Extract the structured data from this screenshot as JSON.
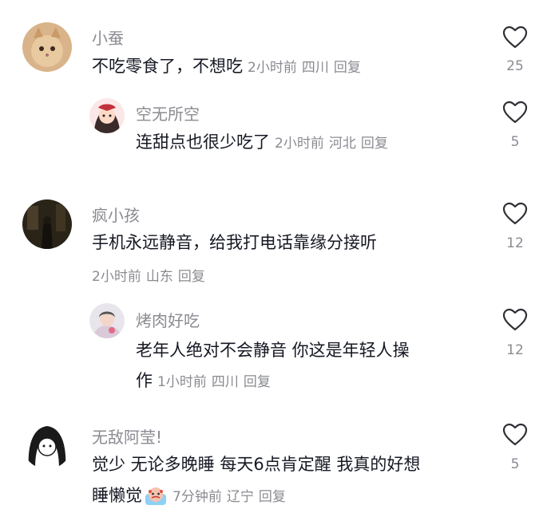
{
  "comments": [
    {
      "username": "小蚕",
      "text": "不吃零食了，不想吃",
      "time": "2小时前",
      "location": "四川",
      "reply_label": "回复",
      "likes": "25"
    },
    {
      "username": "空无所空",
      "text": "连甜点也很少吃了",
      "time": "2小时前",
      "location": "河北",
      "reply_label": "回复",
      "likes": "5"
    },
    {
      "username": "疯小孩",
      "text": "手机永远静音，给我打电话靠缘分接听",
      "time": "2小时前",
      "location": "山东",
      "reply_label": "回复",
      "likes": "12"
    },
    {
      "username": "烤肉好吃",
      "text_line1": "老年人绝对不会静音 你这是年轻人操",
      "text_line2": "作",
      "time": "1小时前",
      "location": "四川",
      "reply_label": "回复",
      "likes": "12"
    },
    {
      "username": "无敌阿莹!",
      "text_line1": "觉少 无论多晚睡 每天6点肯定醒 我真的好想",
      "text_line2": "睡懒觉",
      "time": "7分钟前",
      "location": "辽宁",
      "reply_label": "回复",
      "likes": "5"
    }
  ],
  "icons": {
    "like": "heart-outline-icon",
    "emoji": "crying-face-emoji"
  },
  "colors": {
    "primary_text": "#161823",
    "secondary_text": "#8a8b91",
    "background": "#ffffff"
  }
}
